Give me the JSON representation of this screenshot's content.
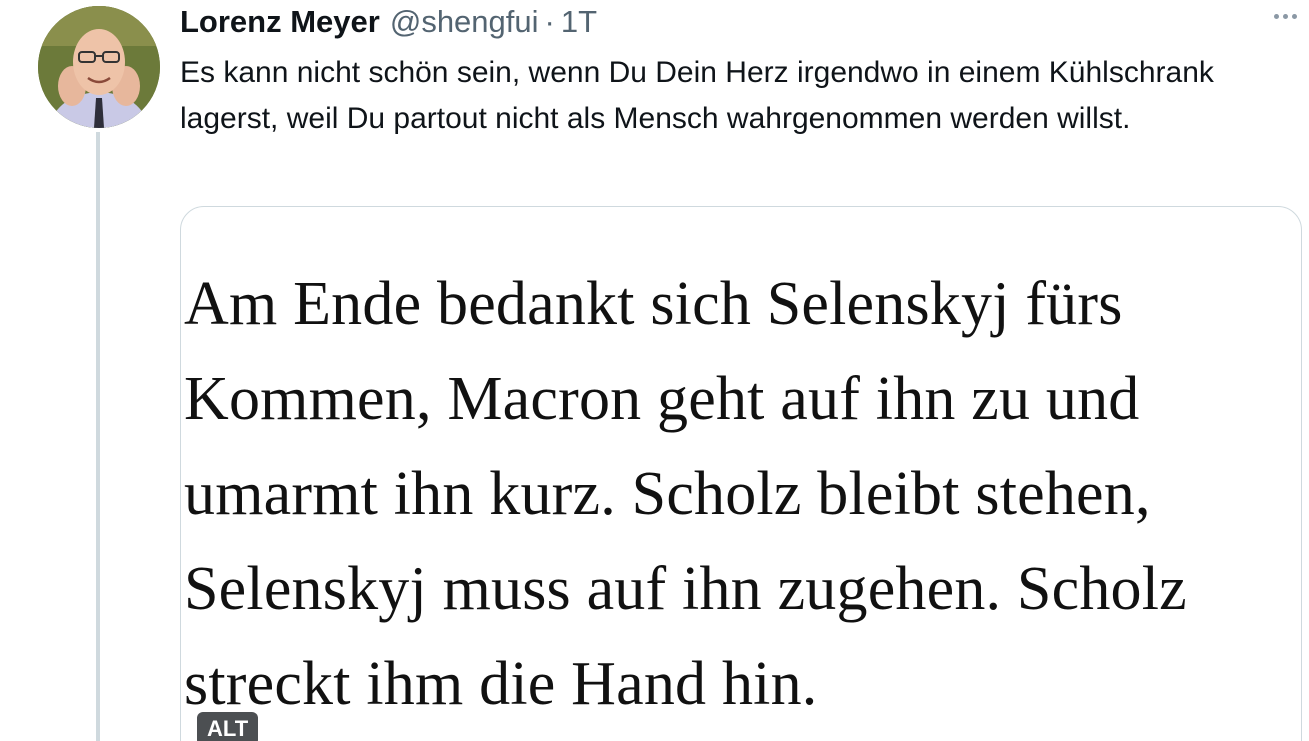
{
  "tweet": {
    "display_name": "Lorenz Meyer",
    "handle": "@shengfui",
    "separator": "·",
    "time": "1T",
    "text": "Es kann nicht schön sein, wenn Du Dein Herz irgendwo in einem Kühlschrank lagerst, weil Du partout nicht als Mensch wahrgenommen werden willst.",
    "more_icon": "more-horizontal-icon",
    "avatar_icon": "avatar"
  },
  "media": {
    "image_text": "Am Ende bedankt sich Selenskyj fürs Kommen, Macron geht auf ihn zu und umarmt ihn kurz. Scholz bleibt stehen, Selenskyj muss auf ihn zugehen. Scholz streckt ihm die Hand hin.",
    "alt_label": "ALT"
  },
  "colors": {
    "text_primary": "#0f1419",
    "text_secondary": "#536471",
    "border": "#cfd9de",
    "alt_badge_bg": "#4c4f52"
  }
}
